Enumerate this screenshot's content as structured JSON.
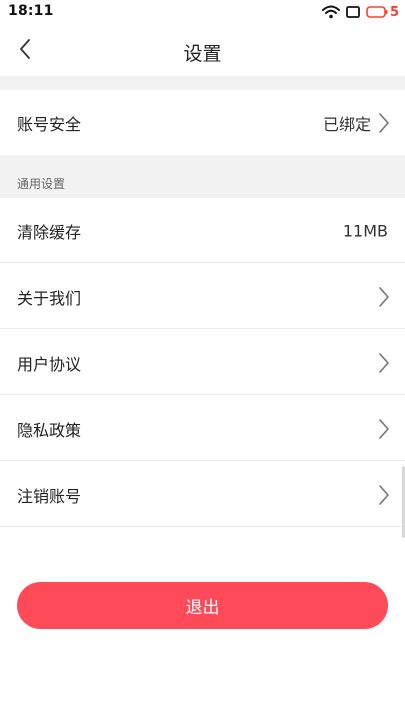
{
  "status_bar": {
    "time": "18:11",
    "battery_level": "5",
    "icons": [
      "wifi-icon",
      "screen-icon",
      "battery-icon"
    ]
  },
  "header": {
    "title": "设置",
    "back_icon": "chevron-left-icon"
  },
  "account": {
    "label": "账号安全",
    "value": "已绑定"
  },
  "general": {
    "section_title": "通用设置",
    "clear_cache": {
      "label": "清除缓存",
      "value": "11MB"
    },
    "items": [
      {
        "label": "关于我们"
      },
      {
        "label": "用户协议"
      },
      {
        "label": "隐私政策"
      },
      {
        "label": "注销账号"
      }
    ]
  },
  "logout": {
    "label": "退出"
  },
  "colors": {
    "accent": "#ff4a5a",
    "background_gray": "#f2f2f2",
    "battery_low": "#ff3b30"
  }
}
